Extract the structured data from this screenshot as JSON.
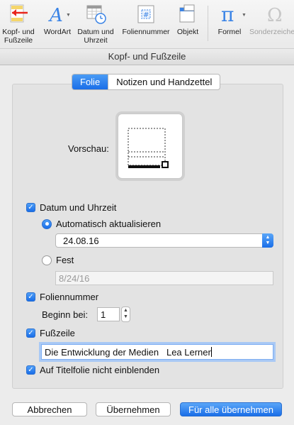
{
  "ribbon": {
    "items": [
      {
        "label": "Kopf- und\nFußzeile",
        "icon": "header-footer-icon"
      },
      {
        "label": "WordArt",
        "icon": "wordart-icon"
      },
      {
        "label": "Datum und\nUhrzeit",
        "icon": "date-time-icon"
      },
      {
        "label": "Foliennummer",
        "icon": "slide-number-icon"
      },
      {
        "label": "Objekt",
        "icon": "object-icon"
      },
      {
        "label": "Formel",
        "icon": "formula-icon"
      },
      {
        "label": "Sonderzeichen",
        "icon": "symbol-icon"
      }
    ]
  },
  "dialog": {
    "title": "Kopf- und Fußzeile",
    "tabs": [
      "Folie",
      "Notizen und Handzettel"
    ],
    "preview_label": "Vorschau:",
    "date_time": {
      "label": "Datum und Uhrzeit",
      "checked": true,
      "auto_label": "Automatisch aktualisieren",
      "auto_value": "24.08.16",
      "fixed_label": "Fest",
      "fixed_value": "8/24/16"
    },
    "slide_number": {
      "label": "Foliennummer",
      "checked": true,
      "start_label": "Beginn bei:",
      "start_value": "1"
    },
    "footer": {
      "label": "Fußzeile",
      "checked": true,
      "value": "Die Entwicklung der Medien   Lea Lerner"
    },
    "hide_title": {
      "label": "Auf Titelfolie nicht einblenden",
      "checked": true
    },
    "buttons": {
      "cancel": "Abbrechen",
      "apply": "Übernehmen",
      "apply_all": "Für alle übernehmen"
    }
  },
  "colors": {
    "accent": "#1a6ee8",
    "arrow": "#e8261c"
  }
}
